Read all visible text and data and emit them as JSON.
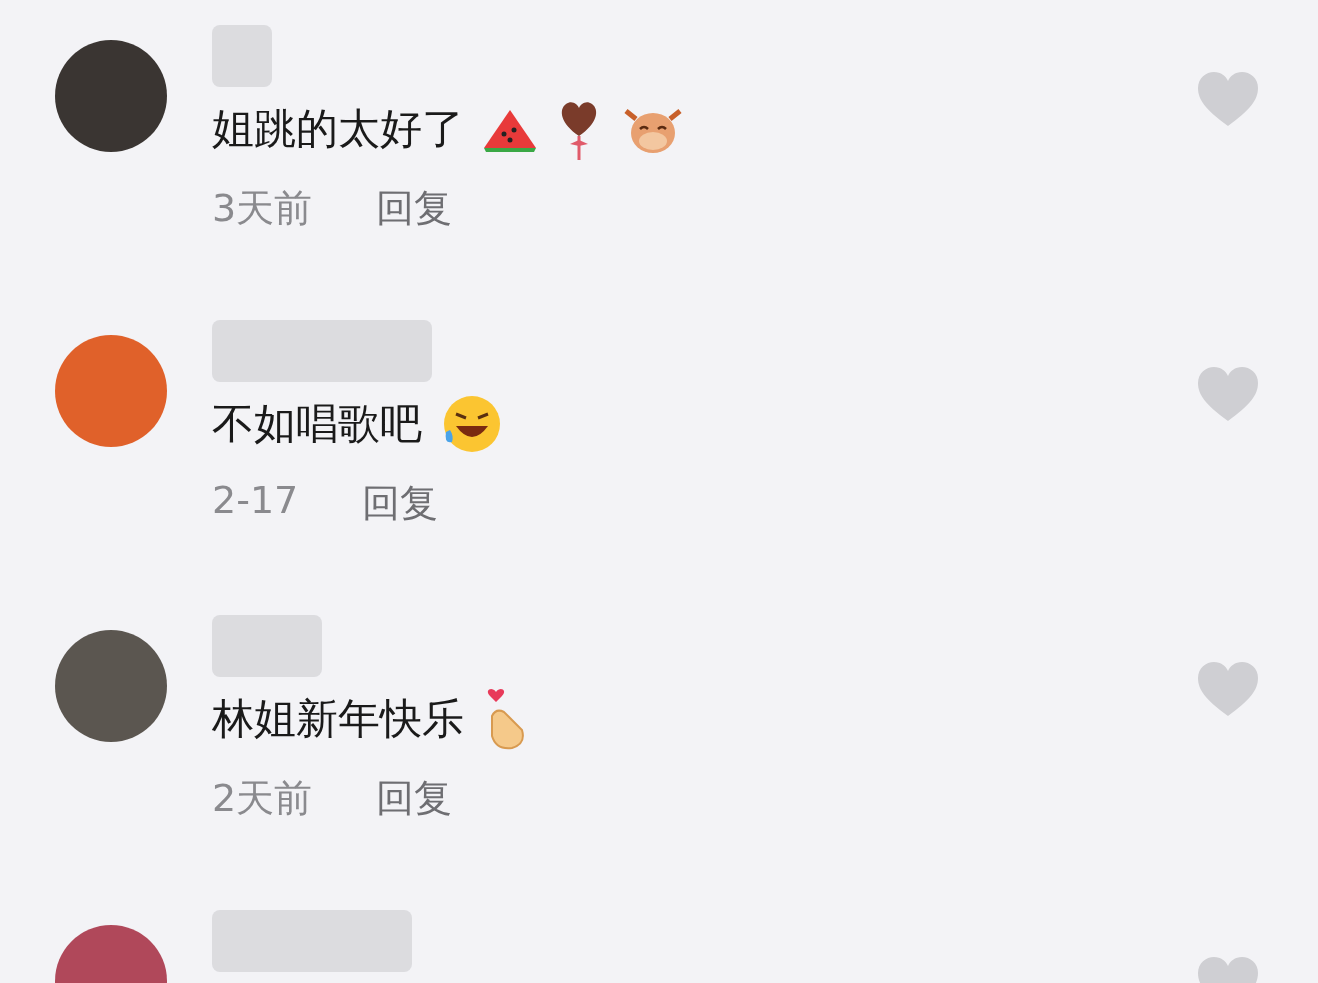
{
  "comments": [
    {
      "color": "#3a3532",
      "text": "姐跳的太好了",
      "emojis": [
        {
          "kind": "watermelon"
        },
        {
          "kind": "lollipop"
        },
        {
          "kind": "ox"
        }
      ],
      "time": "3天前",
      "reply": "回复",
      "liked": false
    },
    {
      "color": "#e0612a",
      "text": "不如唱歌吧",
      "emojis": [
        {
          "kind": "laughing"
        }
      ],
      "time": "2-17",
      "reply": "回复",
      "liked": false
    },
    {
      "color": "#5b5650",
      "text": "林姐新年快乐",
      "emojis": [
        {
          "kind": "fingerheart"
        }
      ],
      "time": "2天前",
      "reply": "回复",
      "liked": false
    },
    {
      "color": "#b0485a",
      "liked": false
    }
  ]
}
